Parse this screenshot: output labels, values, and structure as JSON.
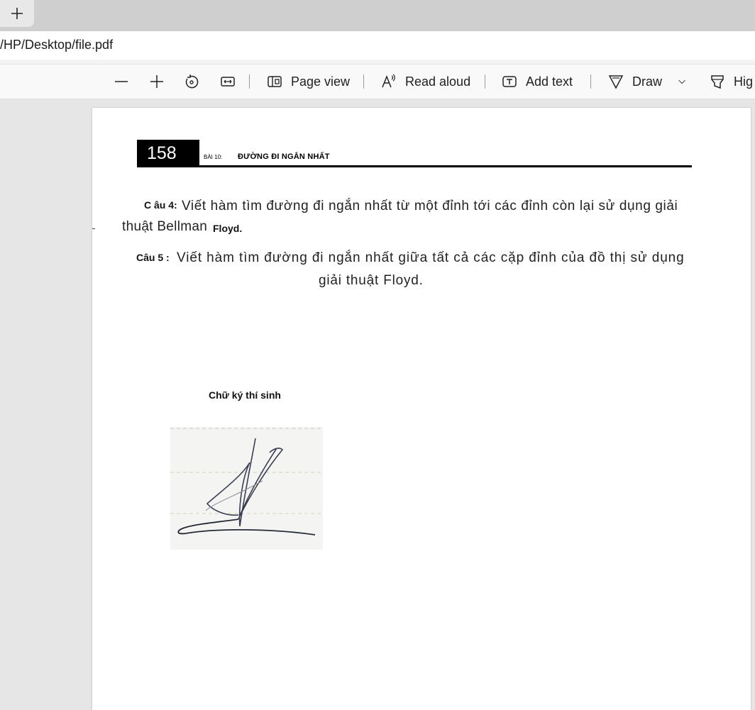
{
  "browser": {
    "url": "/HP/Desktop/file.pdf"
  },
  "toolbar": {
    "page_view": "Page view",
    "read_aloud": "Read aloud",
    "add_text": "Add text",
    "draw": "Draw",
    "highlight": "Hig"
  },
  "document": {
    "page_number": "158",
    "lesson_prefix": "BÀI 10:",
    "lesson_title": "ĐƯỜNG ĐI NGẮN NHẤT",
    "q4_label": "C âu 4:",
    "q4_line1": "Viết hàm tìm đường đi ngắn nhất từ một đỉnh tới các đỉnh còn lại sử dụng giải",
    "q4_line2": "thuật Bellman",
    "q4_line2_suffix": "Floyd.",
    "q5_label": "Câu 5 :",
    "q5_line1": "Viết hàm tìm đường đi ngắn nhất giữa tất cả các cặp đỉnh của đồ thị sử dụng",
    "q5_line2": "giải thuật Floyd.",
    "signature_label": "Chữ ký thí sinh"
  }
}
